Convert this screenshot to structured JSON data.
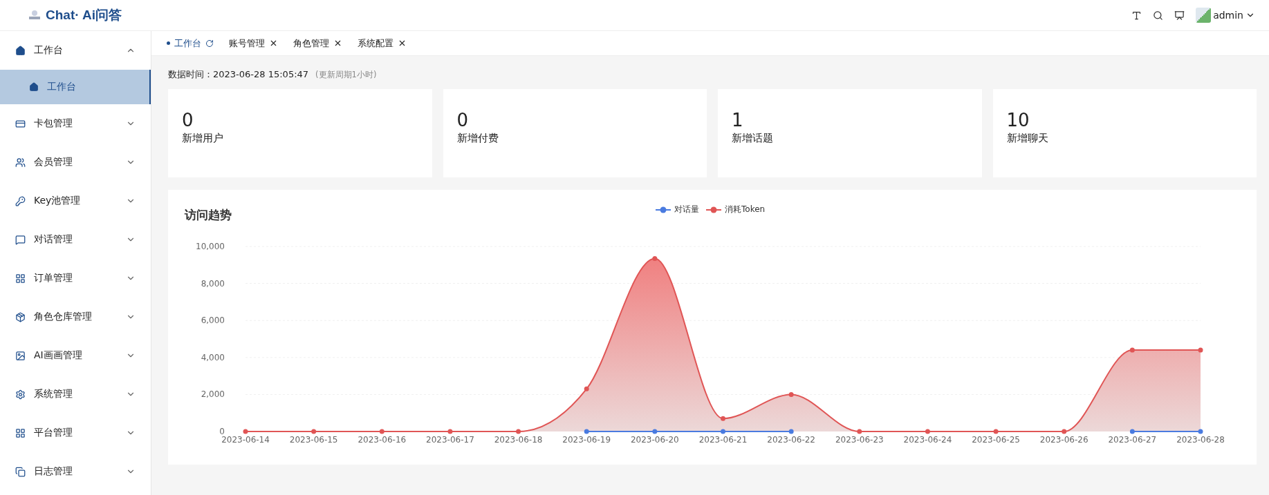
{
  "header": {
    "logo_text": "Chat· Ai问答",
    "user": "admin"
  },
  "sidebar": {
    "items": [
      {
        "label": "工作台",
        "expanded": true,
        "children": [
          {
            "label": "工作台",
            "selected": true
          }
        ]
      },
      {
        "label": "卡包管理",
        "expanded": false
      },
      {
        "label": "会员管理",
        "expanded": false
      },
      {
        "label": "Key池管理",
        "expanded": false
      },
      {
        "label": "对话管理",
        "expanded": false
      },
      {
        "label": "订单管理",
        "expanded": false
      },
      {
        "label": "角色仓库管理",
        "expanded": false
      },
      {
        "label": "AI画画管理",
        "expanded": false
      },
      {
        "label": "系统管理",
        "expanded": false
      },
      {
        "label": "平台管理",
        "expanded": false
      },
      {
        "label": "日志管理",
        "expanded": false
      }
    ]
  },
  "tabs": [
    {
      "label": "工作台",
      "selected": true
    },
    {
      "label": "账号管理",
      "selected": false
    },
    {
      "label": "角色管理",
      "selected": false
    },
    {
      "label": "系统配置",
      "selected": false
    }
  ],
  "data_time": {
    "text": "数据时间：2023-06-28 15:05:47",
    "note": "(更新周期1小时)"
  },
  "stats": [
    {
      "value": "0",
      "label": "新增用户"
    },
    {
      "value": "0",
      "label": "新增付费"
    },
    {
      "value": "1",
      "label": "新增话题"
    },
    {
      "value": "10",
      "label": "新增聊天"
    }
  ],
  "trend": {
    "title": "访问趋势",
    "chart_data": {
      "type": "area",
      "grid": true,
      "categories": [
        "2023-06-14",
        "2023-06-15",
        "2023-06-16",
        "2023-06-17",
        "2023-06-18",
        "2023-06-19",
        "2023-06-20",
        "2023-06-21",
        "2023-06-22",
        "2023-06-23",
        "2023-06-24",
        "2023-06-25",
        "2023-06-26",
        "2023-06-27",
        "2023-06-28"
      ],
      "series": [
        {
          "name": "对话量",
          "type": "line",
          "color": "#4a7be0",
          "marker": true,
          "values": [
            null,
            null,
            null,
            null,
            null,
            0,
            0,
            0,
            0,
            null,
            null,
            null,
            null,
            0,
            0
          ]
        },
        {
          "name": "消耗Token",
          "color": "#e05555",
          "marker": true,
          "values": [
            0,
            0,
            0,
            0,
            0,
            2300,
            9350,
            700,
            2000,
            0,
            0,
            0,
            0,
            4400,
            4400
          ]
        }
      ],
      "ylim": [
        0,
        10000
      ],
      "yticks": [
        0,
        {
          "value": 2000,
          "label": "2,000"
        },
        {
          "value": 4000,
          "label": "4,000"
        },
        {
          "value": 6000,
          "label": "6,000"
        },
        {
          "value": 8000,
          "label": "8,000"
        },
        {
          "value": 10000,
          "label": "10,000"
        }
      ]
    }
  }
}
